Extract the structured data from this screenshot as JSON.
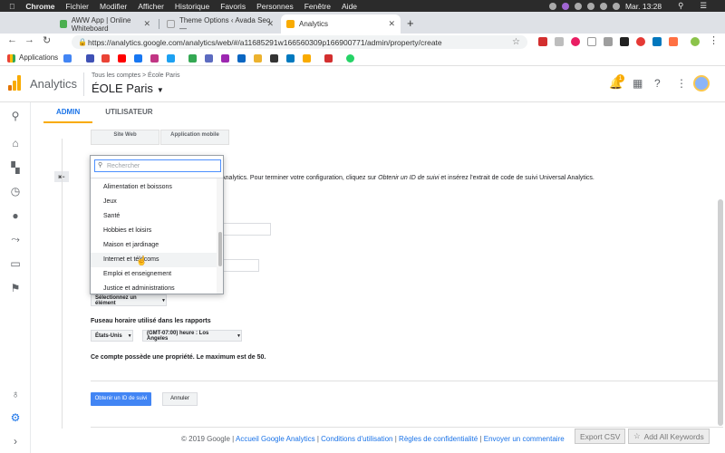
{
  "mac_menubar": {
    "items": [
      "Chrome",
      "Fichier",
      "Modifier",
      "Afficher",
      "Historique",
      "Favoris",
      "Personnes",
      "Fenêtre",
      "Aide"
    ],
    "clock": "Mar. 13:28"
  },
  "browser": {
    "tabs": [
      {
        "title": "AWW App | Online Whiteboard",
        "favicon_color": "#4caf50"
      },
      {
        "title": "Theme Options ‹ Avada Seo —",
        "favicon_color": "#9e9e9e"
      },
      {
        "title": "Analytics",
        "favicon_color": "#f9ab00"
      }
    ],
    "url": "https://analytics.google.com/analytics/web/#/a11685291w166560309p166900771/admin/property/create",
    "bookmarks_label": "Applications"
  },
  "app": {
    "name": "Analytics",
    "breadcrumb": "Tous les comptes > École Paris",
    "property": "ÉOLE Paris",
    "notification_count": "1"
  },
  "admin_tabs": [
    "ADMIN",
    "UTILISATEUR"
  ],
  "form": {
    "segments": [
      "Site Web",
      "Application mobile"
    ],
    "info_prefix": "Analytics. Pour terminer votre configuration, cliquez sur ",
    "info_link": "Obtenir un ID de suivi",
    "info_suffix": " et insérez l'extrait de code de suivi Universal Analytics.",
    "industry_select": "Sélectionnez un élément",
    "timezone_label": "Fuseau horaire utilisé dans les rapports",
    "timezone_country": "États-Unis",
    "timezone_value": "(GMT-07:00) heure : Los Angeles",
    "property_count_note": "Ce compte possède une propriété. Le maximum est de 50.",
    "submit_label": "Obtenir un ID de suivi",
    "cancel_label": "Annuler"
  },
  "dropdown": {
    "search_placeholder": "Rechercher",
    "items": [
      "Alimentation et boissons",
      "Jeux",
      "Santé",
      "Hobbies et loisirs",
      "Maison et jardinage",
      "Internet et télécoms",
      "Emploi et enseignement",
      "Justice et administrations"
    ],
    "hovered_index": 5
  },
  "footer": {
    "copyright": "© 2019 Google | ",
    "links": [
      "Accueil Google Analytics",
      "Conditions d'utilisation",
      "Règles de confidentialité",
      "Envoyer un commentaire"
    ]
  },
  "extension_buttons": {
    "export": "Export CSV",
    "add_keywords": "Add All Keywords"
  },
  "colors": {
    "accent": "#1a73e8",
    "ga_orange": "#f9ab00",
    "ga_dark_orange": "#e37400",
    "primary_button": "#4285f4"
  }
}
